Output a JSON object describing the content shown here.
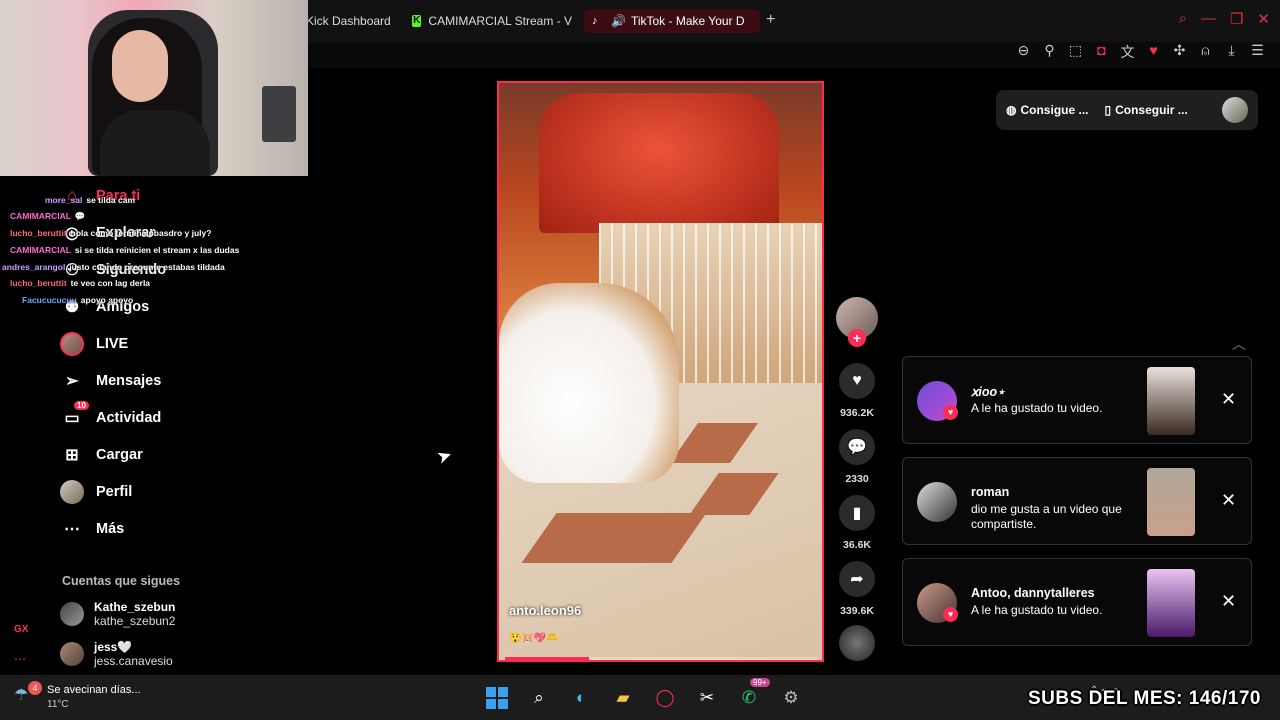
{
  "browser": {
    "tabs": [
      {
        "label": "Kick Dashboard",
        "active": false
      },
      {
        "label": "CAMIMARCIAL Stream - V",
        "active": false
      },
      {
        "label": "TikTok - Make Your D",
        "active": true
      }
    ],
    "new_tab": "+"
  },
  "sidebar": {
    "items": [
      {
        "label": "Para ti",
        "icon": "home-icon"
      },
      {
        "label": "Explorar",
        "icon": "compass-icon"
      },
      {
        "label": "Siguiendo",
        "icon": "following-icon"
      },
      {
        "label": "Amigos",
        "icon": "friends-icon"
      },
      {
        "label": "LIVE",
        "icon": "live-avatar"
      },
      {
        "label": "Mensajes",
        "icon": "send-icon"
      },
      {
        "label": "Actividad",
        "icon": "activity-icon",
        "badge": "10"
      },
      {
        "label": "Cargar",
        "icon": "upload-icon"
      },
      {
        "label": "Perfil",
        "icon": "profile-avatar"
      },
      {
        "label": "Más",
        "icon": "more-icon"
      }
    ],
    "following_header": "Cuentas que sigues",
    "following": [
      {
        "name": "Kathe_szebun",
        "user": "kathe_szebun2"
      },
      {
        "name": "jess🤍",
        "user": "jess.canavesio"
      }
    ]
  },
  "chat": [
    {
      "user": "more_sal",
      "msg": "se tilda cam",
      "color": "#c9a0ff"
    },
    {
      "user": "CAMIMARCIAL",
      "msg": "💬",
      "color": "#ff6bd5"
    },
    {
      "user": "lucho_beruttit",
      "msg": "hola como termina pbasdro y july?",
      "color": "#ff6b6b"
    },
    {
      "user": "CAMIMARCIAL",
      "msg": "si se tilda reinicien el stream x las dudas",
      "color": "#ff6bd5"
    },
    {
      "user": "andres_arangol",
      "msg": "justo cuando pregunte estabas tildada",
      "color": "#c9a0ff"
    },
    {
      "user": "lucho_beruttit",
      "msg": "te veo con lag derla",
      "color": "#ff6b6b"
    },
    {
      "user": "Facucucucuu",
      "msg": "apoyo apoyo",
      "color": "#6ba8ff"
    }
  ],
  "topbar_buttons": {
    "coins": "Consigue ...",
    "app": "Conseguir ..."
  },
  "video": {
    "author": "anto.leon96",
    "emojis": "😲🐹💖🫶",
    "progress": 0.27
  },
  "actions": {
    "likes": "936.2K",
    "comments": "2330",
    "saves": "36.6K",
    "shares": "339.6K"
  },
  "notifications": [
    {
      "name": "ⅹiᴏᴏ⋆",
      "text": "A le ha gustado tu video."
    },
    {
      "name": "roman",
      "text": "dio me gusta a un video que compartiste."
    },
    {
      "name": "Antoo, dannytalleres",
      "text": "A le ha gustado tu video."
    }
  ],
  "taskbar": {
    "weather_title": "Se avecinan días...",
    "weather_temp": "11°C",
    "weather_badge": "4",
    "whatsapp_badge": "99+"
  },
  "overlay": {
    "subs": "SUBS DEL MES: 146/170"
  },
  "colors": {
    "accent": "#fe2c55",
    "background": "#000000"
  }
}
